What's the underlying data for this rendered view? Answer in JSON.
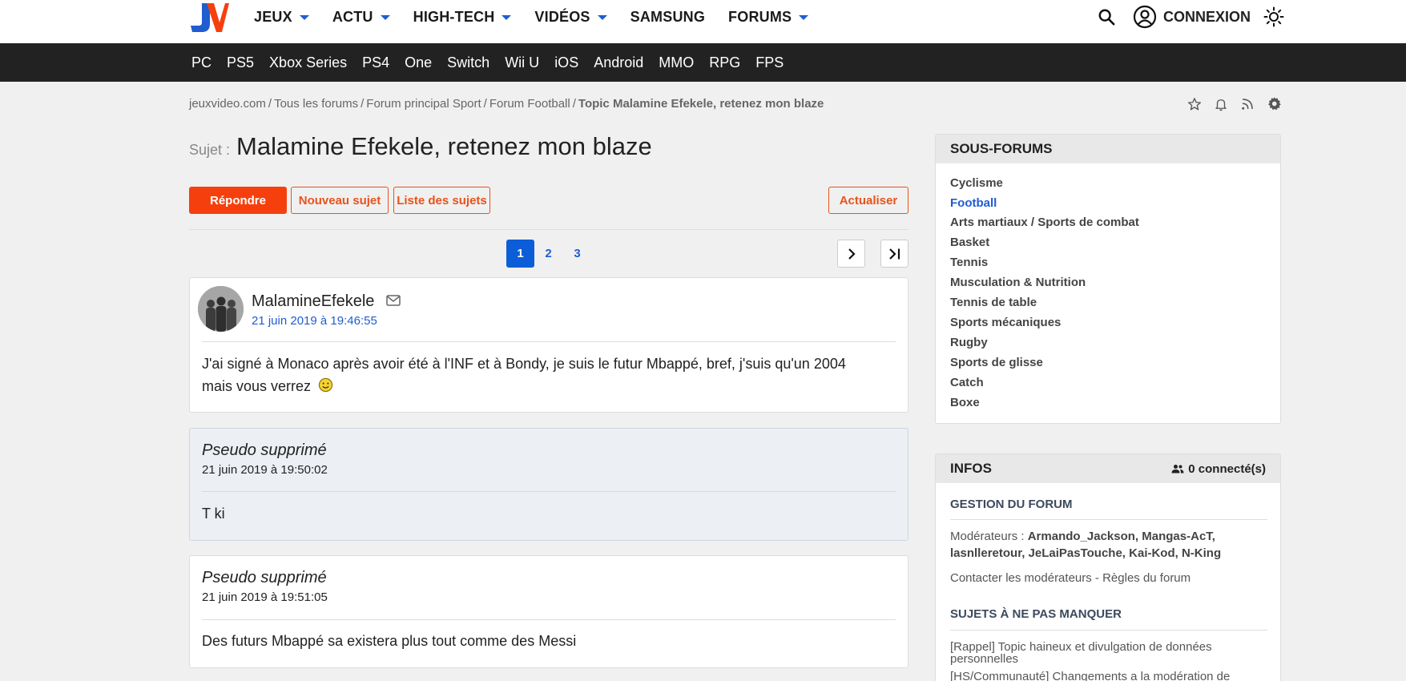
{
  "header": {
    "logo": "JV",
    "nav": [
      {
        "label": "JEUX",
        "dropdown": true
      },
      {
        "label": "ACTU",
        "dropdown": true
      },
      {
        "label": "HIGH-TECH",
        "dropdown": true
      },
      {
        "label": "VIDÉOS",
        "dropdown": true
      },
      {
        "label": "SAMSUNG",
        "dropdown": false
      },
      {
        "label": "FORUMS",
        "dropdown": true
      }
    ],
    "login_label": "CONNEXION",
    "icons": [
      "search-icon",
      "user-circle-icon",
      "sun-icon"
    ]
  },
  "platforms": [
    "PC",
    "PS5",
    "Xbox Series",
    "PS4",
    "One",
    "Switch",
    "Wii U",
    "iOS",
    "Android",
    "MMO",
    "RPG",
    "FPS"
  ],
  "breadcrumb": [
    "jeuxvideo.com",
    "Tous les forums",
    "Forum principal Sport",
    "Forum Football",
    "Topic Malamine Efekele, retenez mon blaze"
  ],
  "topic": {
    "label": "Sujet :",
    "title": "Malamine Efekele, retenez mon blaze",
    "tools": [
      "star-icon",
      "bell-icon",
      "rss-icon",
      "gear-icon"
    ]
  },
  "actions": {
    "reply": "Répondre",
    "new_topic": "Nouveau sujet",
    "topic_list": "Liste des sujets",
    "refresh": "Actualiser"
  },
  "pagination": {
    "pages": [
      "1",
      "2",
      "3"
    ],
    "current": "1"
  },
  "posts": [
    {
      "author": "MalamineEfekele",
      "date": "21 juin 2019 à 19:46:55",
      "content": "J'ai signé à Monaco après avoir été à l'INF et à Bondy, je suis le futur Mbappé, bref, j'suis qu'un 2004 mais vous verrez",
      "emoji": "smiley-icon"
    },
    {
      "author": "Pseudo supprimé",
      "date": "21 juin 2019 à 19:50:02",
      "content": "T ki"
    },
    {
      "author": "Pseudo supprimé",
      "date": "21 juin 2019 à 19:51:05",
      "content": "Des futurs Mbappé sa existera plus tout comme des Messi"
    }
  ],
  "sidebar": {
    "subforums_title": "SOUS-FORUMS",
    "subforums": [
      "Cyclisme",
      "Football",
      "Arts martiaux / Sports de combat",
      "Basket",
      "Tennis",
      "Musculation & Nutrition",
      "Tennis de table",
      "Sports mécaniques",
      "Rugby",
      "Sports de glisse",
      "Catch",
      "Boxe"
    ],
    "active_subforum": "Football",
    "infos_title": "INFOS",
    "connected": "0 connecté(s)",
    "management_title": "GESTION DU FORUM",
    "moderators_label": "Modérateurs :",
    "moderators_line1": "Armando_Jackson, Mangas-AcT,",
    "moderators_line2": "lasnlleretour, JeLaiPasTouche, Kai-Kod, N-King",
    "contact": "Contacter les modérateurs",
    "contact_sep": " - ",
    "rules": "Règles du forum",
    "must_read_title": "SUJETS À NE PAS MANQUER",
    "must_read": [
      "[Rappel] Topic haineux et divulgation de données personnelles",
      "[HS/Communauté] Changements a la modération de"
    ]
  }
}
